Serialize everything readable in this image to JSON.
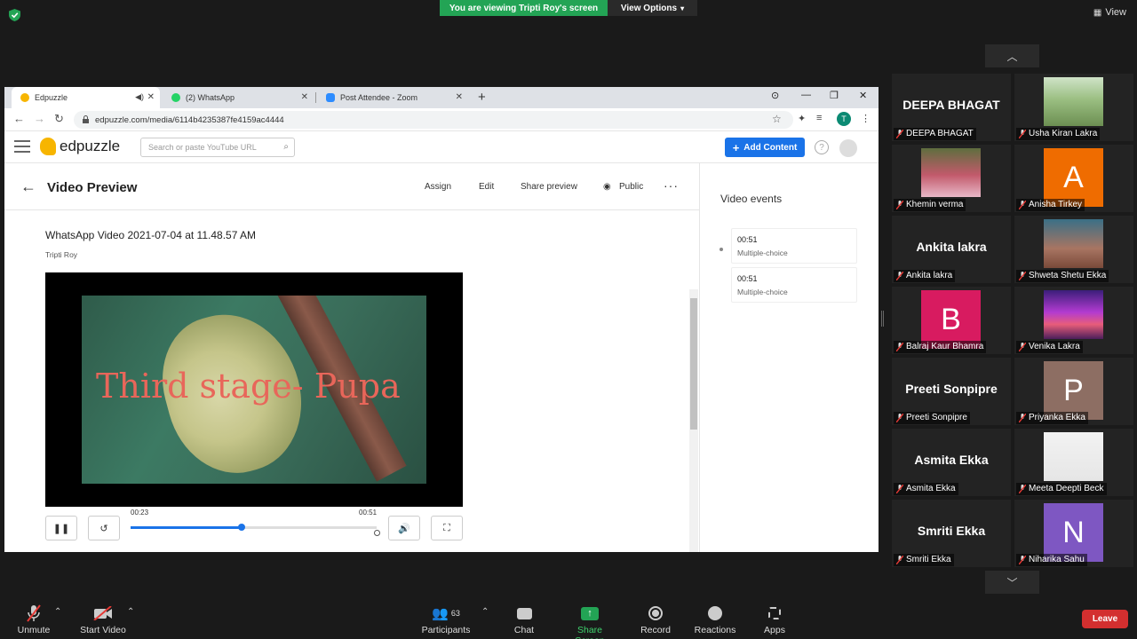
{
  "zoom": {
    "viewing_banner": "You are viewing Tripti Roy's screen",
    "view_options": "View Options",
    "view_button": "View",
    "colors": {
      "banner": "#23a455",
      "leave": "#d32f2f"
    }
  },
  "browser": {
    "tabs": [
      {
        "label": "Edpuzzle",
        "icon": "edpuzzle-favicon"
      },
      {
        "label": "(2) WhatsApp",
        "icon": "whatsapp-favicon"
      },
      {
        "label": "Post Attendee - Zoom",
        "icon": "zoom-favicon"
      }
    ],
    "url": "edpuzzle.com/media/6114b4235387fe4159ac4444",
    "profile_initial": "T"
  },
  "edpuzzle": {
    "logo_text": "edpuzzle",
    "search_placeholder": "Search or paste YouTube URL",
    "add_content": "Add Content",
    "page_title": "Video Preview",
    "actions": {
      "assign": "Assign",
      "edit": "Edit",
      "share_preview": "Share preview",
      "public": "Public"
    },
    "video": {
      "title": "WhatsApp Video 2021-07-04 at 11.48.57 AM",
      "author": "Tripti Roy",
      "caption": "Third stage- Pupa",
      "current_time": "00:23",
      "duration": "00:51",
      "progress": 0.45
    },
    "side": {
      "title": "Video events",
      "events": [
        {
          "time": "00:51",
          "kind": "Multiple-choice"
        },
        {
          "time": "00:51",
          "kind": "Multiple-choice"
        }
      ]
    }
  },
  "participants": [
    {
      "name": "DEEPA BHAGAT",
      "big": "DEEPA BHAGAT"
    },
    {
      "name": "Usha Kiran Lakra"
    },
    {
      "name": "Khemin verma"
    },
    {
      "name": "Anisha Tirkey",
      "initial": "A",
      "color": "#ef6c00"
    },
    {
      "name": "Ankita lakra",
      "big": "Ankita lakra"
    },
    {
      "name": "Shweta Shetu Ekka"
    },
    {
      "name": "Balraj Kaur Bhamra",
      "initial": "B",
      "color": "#d81b60"
    },
    {
      "name": "Venika Lakra"
    },
    {
      "name": "Preeti Sonpipre",
      "big": "Preeti Sonpipre"
    },
    {
      "name": "Priyanka Ekka",
      "initial": "P",
      "color": "#8d6e63"
    },
    {
      "name": "Asmita Ekka",
      "big": "Asmita Ekka"
    },
    {
      "name": "Meeta Deepti Beck"
    },
    {
      "name": "Smriti Ekka",
      "big": "Smriti Ekka"
    },
    {
      "name": "Niharika Sahu",
      "initial": "N",
      "color": "#7e57c2"
    }
  ],
  "toolbar": {
    "unmute": "Unmute",
    "start_video": "Start Video",
    "participants": "Participants",
    "participants_count": "63",
    "chat": "Chat",
    "share_screen": "Share Screen",
    "record": "Record",
    "reactions": "Reactions",
    "apps": "Apps",
    "leave": "Leave"
  }
}
